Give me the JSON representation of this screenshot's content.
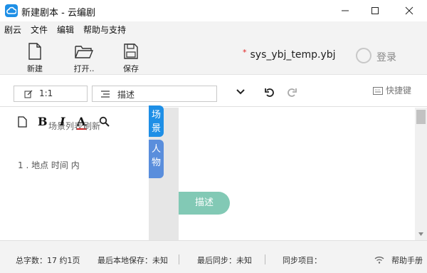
{
  "window": {
    "title": "新建剧本 - 云编剧",
    "minimize_icon": "minimize-icon",
    "maximize_icon": "maximize-icon",
    "close_icon": "close-icon"
  },
  "menu": [
    "剧云",
    "文件",
    "编辑",
    "帮助与支持"
  ],
  "toolbar": {
    "new_label": "新建",
    "open_label": "打开..",
    "save_label": "保存",
    "file_name": "sys_ybj_temp.ybj",
    "unsaved_marker": "*",
    "login_label": "登录"
  },
  "editor_toolbar": {
    "scale_value": "1:1",
    "element_type": "描述",
    "shortcut_label": "快捷键"
  },
  "scene_panel": {
    "scene_list_label": "场景列表",
    "refresh_label": "刷新",
    "bold": "B",
    "italic": "I",
    "color": "A",
    "scenes": [
      "1 . 地点 时间 内"
    ]
  },
  "side_tabs": {
    "scene": "场景",
    "character": "人物"
  },
  "content": {
    "description_pill": "描述"
  },
  "status": {
    "word_count": "总字数：17 约1页",
    "last_local_save": "最后本地保存：未知",
    "last_sync": "最后同步：未知",
    "sync_items": "同步项目：",
    "help": "帮助手册"
  },
  "colors": {
    "accent": "#1e8fe6",
    "tab_character": "#5a8edc",
    "description_pill": "#82c9b5",
    "unsaved_marker": "#e02020"
  }
}
